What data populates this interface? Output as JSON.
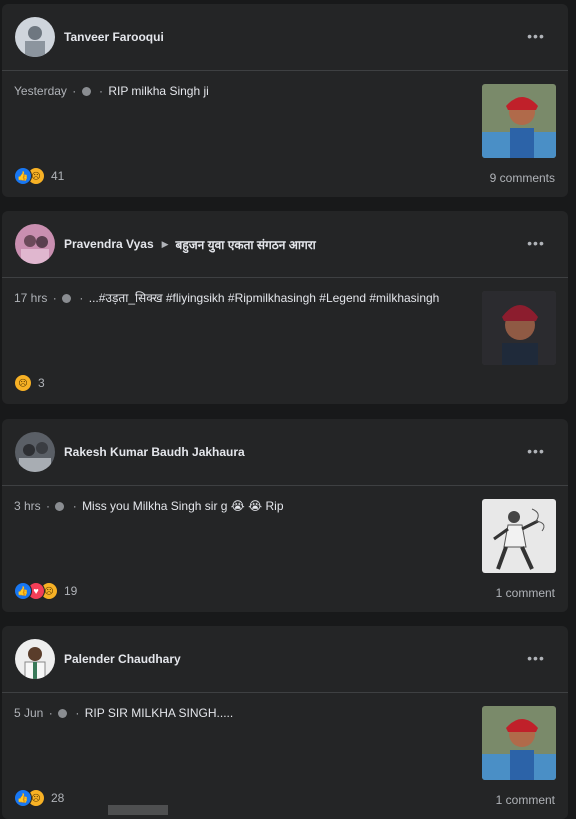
{
  "posts": [
    {
      "author": "Tanveer Farooqui",
      "group": "",
      "time": "Yesterday",
      "text": "RIP milkha Singh ji",
      "reactions": [
        "like",
        "sad"
      ],
      "reaction_count": "41",
      "comments": "9 comments"
    },
    {
      "author": "Pravendra Vyas",
      "group": "बहुजन युवा एकता संगठन आगरा",
      "time": "17 hrs",
      "text": "...#उड़ता_सिक्ख #fliyingsikh #Ripmilkhasingh #Legend #milkhasingh",
      "reactions": [
        "sad"
      ],
      "reaction_count": "3",
      "comments": ""
    },
    {
      "author": "Rakesh Kumar Baudh Jakhaura",
      "group": "",
      "time": "3 hrs",
      "text": "Miss you Milkha Singh sir g 😭 😭 Rip",
      "reactions": [
        "like",
        "love",
        "sad"
      ],
      "reaction_count": "19",
      "comments": "1 comment"
    },
    {
      "author": "Palender Chaudhary",
      "group": "",
      "time": "5 Jun",
      "text": "RIP SIR MILKHA SINGH.....",
      "reactions": [
        "like",
        "sad"
      ],
      "reaction_count": "28",
      "comments": "1 comment"
    }
  ],
  "ui": {
    "separator": "·",
    "more": "•••"
  }
}
